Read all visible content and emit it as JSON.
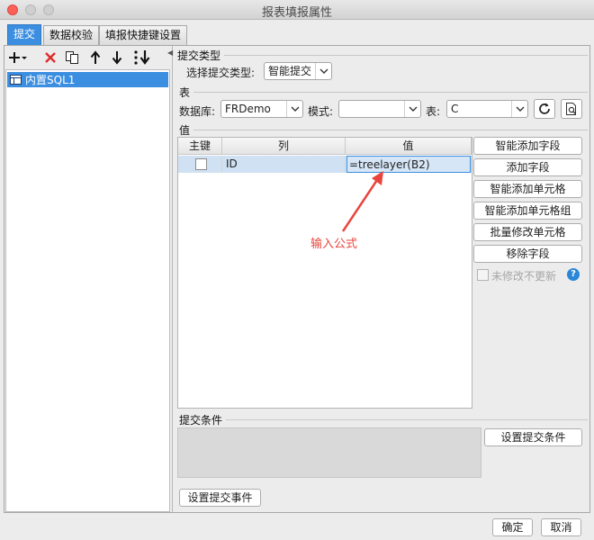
{
  "window": {
    "title": "报表填报属性"
  },
  "tabs": [
    {
      "label": "提交"
    },
    {
      "label": "数据校验"
    },
    {
      "label": "填报快捷键设置"
    }
  ],
  "left_panel": {
    "items": [
      {
        "label": "内置SQL1"
      }
    ]
  },
  "submit_type": {
    "section_label": "提交类型",
    "select_label": "选择提交类型:",
    "selected": "智能提交"
  },
  "table_section": {
    "section_label": "表",
    "database_label": "数据库:",
    "database_value": "FRDemo",
    "schema_label": "模式:",
    "schema_value": "",
    "table_label": "表:",
    "table_value": "C"
  },
  "value_section": {
    "section_label": "值",
    "columns": [
      "主键",
      "列",
      "值"
    ],
    "rows": [
      {
        "key_checked": false,
        "column": "ID",
        "value": "=treelayer(B2)"
      }
    ],
    "buttons": {
      "smart_add_field": "智能添加字段",
      "add_field": "添加字段",
      "smart_add_cell": "智能添加单元格",
      "smart_add_cell_group": "智能添加单元格组",
      "batch_modify_cell": "批量修改单元格",
      "remove_field": "移除字段"
    },
    "no_update_unmodified": "未修改不更新"
  },
  "annotation": {
    "text": "输入公式",
    "color": "#e8453c"
  },
  "condition_section": {
    "section_label": "提交条件",
    "set_condition_button": "设置提交条件"
  },
  "set_event_button": "设置提交事件",
  "footer": {
    "ok": "确定",
    "cancel": "取消"
  },
  "colors": {
    "accent": "#3b8ee0",
    "delete": "#e02b2b",
    "help": "#2a87d8"
  }
}
